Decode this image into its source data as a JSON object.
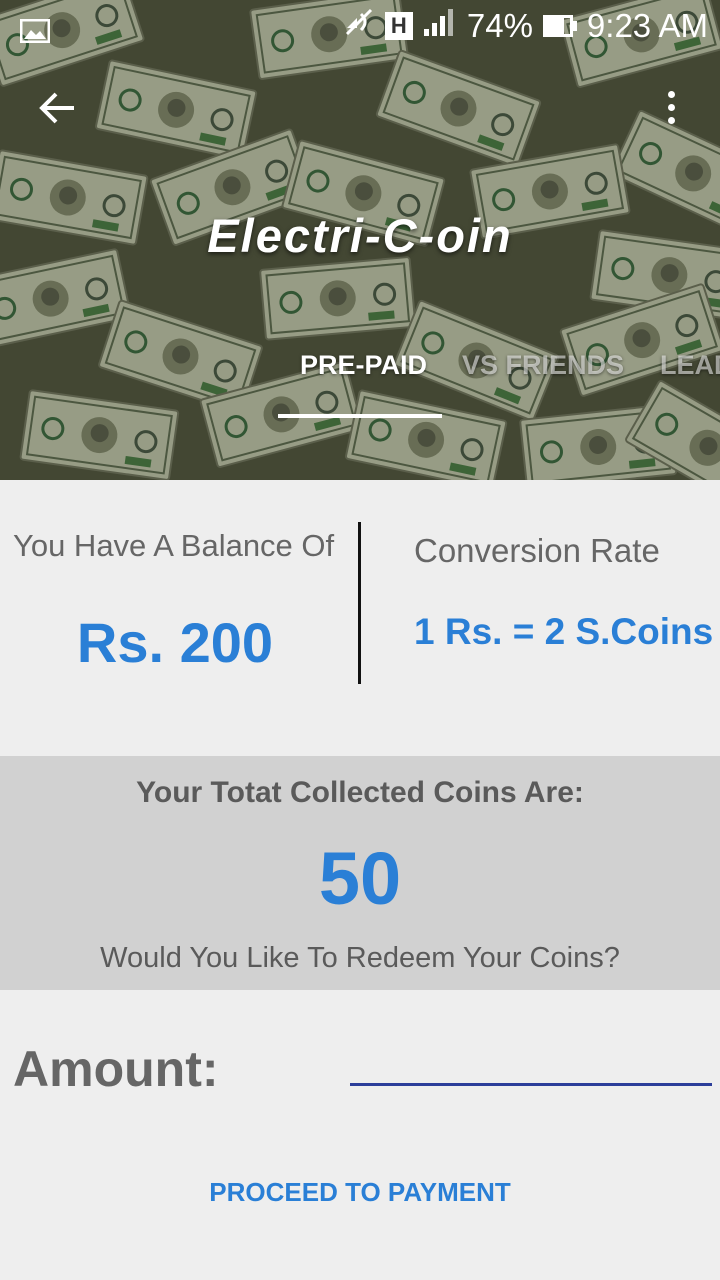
{
  "status_bar": {
    "battery": "74%",
    "time": "9:23 AM",
    "network_badge": "H",
    "icons": [
      "image-notification-icon",
      "mute-icon",
      "signal-icon",
      "battery-icon"
    ]
  },
  "app_bar": {
    "title": "Electri-C-oin",
    "back_icon": "arrow-left-icon",
    "menu_icon": "more-vertical-icon"
  },
  "tabs": [
    {
      "label": "PRE-PAID",
      "active": true
    },
    {
      "label": "VS FRIENDS",
      "active": false
    },
    {
      "label": "LEAD",
      "active": false
    }
  ],
  "balance": {
    "label": "You Have A Balance Of",
    "value": "Rs. 200"
  },
  "conversion": {
    "label": "Conversion Rate",
    "value": "1 Rs. = 2 S.Coins"
  },
  "coins": {
    "title": "Your Totat Collected Coins Are:",
    "value": "50",
    "question": "Would You Like To Redeem Your Coins?"
  },
  "form": {
    "amount_label": "Amount:",
    "amount_value": "",
    "proceed_label": "PROCEED TO PAYMENT"
  },
  "colors": {
    "accent": "#2a7fd6",
    "input_underline": "#2c3e9a",
    "coins_bg": "#d1d1d1",
    "page_bg": "#eeeeee"
  }
}
